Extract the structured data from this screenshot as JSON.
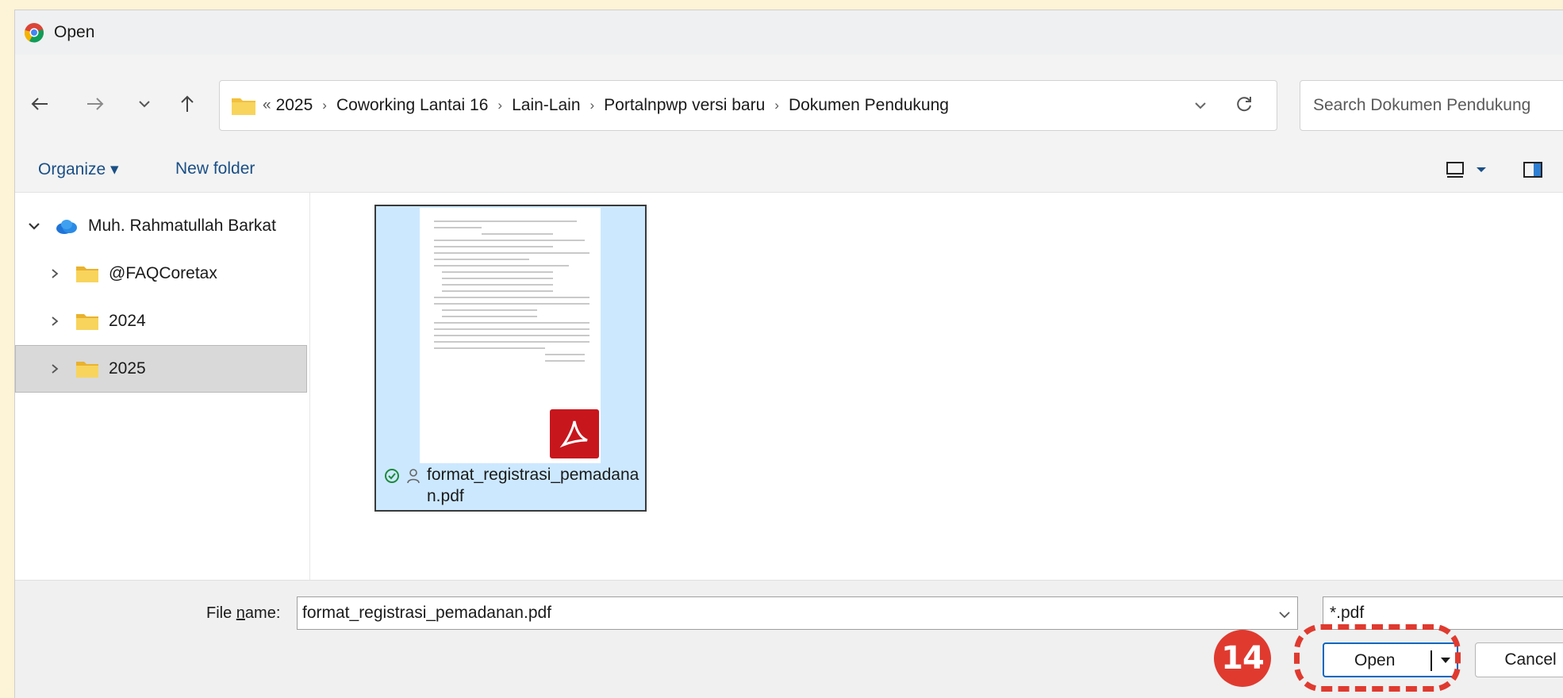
{
  "window": {
    "title": "Open"
  },
  "breadcrumb": {
    "overflow": "«",
    "items": [
      "2025",
      "Coworking Lantai 16",
      "Lain-Lain",
      "Portalnpwp versi baru",
      "Dokumen Pendukung"
    ]
  },
  "search": {
    "placeholder": "Search Dokumen Pendukung"
  },
  "toolbar": {
    "organize_label": "Organize ▾",
    "new_folder_label": "New folder"
  },
  "sidebar": {
    "items": [
      {
        "label": "Muh. Rahmatullah  Barkat",
        "icon": "onedrive-cloud-icon",
        "expanded": true
      },
      {
        "label": "@FAQCoretax",
        "icon": "folder-icon",
        "expanded": false
      },
      {
        "label": "2024",
        "icon": "folder-icon",
        "expanded": false
      },
      {
        "label": "2025",
        "icon": "folder-icon",
        "expanded": false,
        "selected": true
      }
    ]
  },
  "files": [
    {
      "name": "format_registrasi_pemadanan.pdf",
      "type": "pdf",
      "selected": true,
      "sync_status": "available"
    }
  ],
  "bottom": {
    "file_name_label": "File name:",
    "file_name_value": "format_registrasi_pemadanan.pdf",
    "file_type_filter": "*.pdf",
    "open_label": "Open",
    "cancel_label": "Cancel"
  },
  "annotation": {
    "step_number": "14"
  },
  "colors": {
    "accent": "#0067c0",
    "selection": "#cce8ff",
    "folder": "#f3c03c",
    "annotation_red": "#e03a2f",
    "pdf_red": "#c8161d"
  }
}
